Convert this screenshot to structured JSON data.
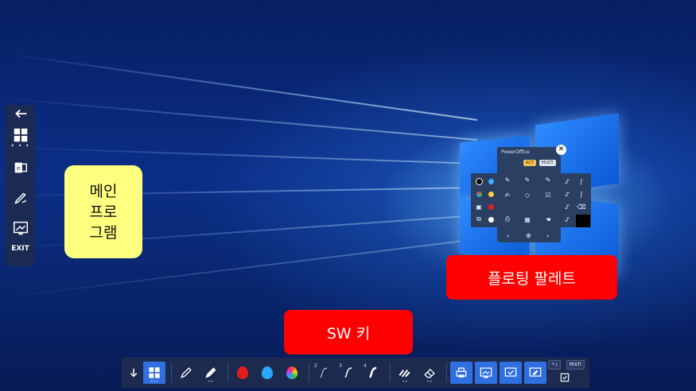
{
  "sidebar": {
    "back_icon": "back-arrow-icon",
    "items": [
      {
        "name": "windows",
        "icon": "windows-icon",
        "dots": "• • •"
      },
      {
        "name": "office",
        "icon": "office-icon",
        "dots": ""
      },
      {
        "name": "pen",
        "icon": "pen-icon",
        "dots": ""
      },
      {
        "name": "whiteboard",
        "icon": "whiteboard-icon",
        "dots": ""
      }
    ],
    "exit_label": "EXIT"
  },
  "callouts": {
    "main_program": "메인\n프로\n그램",
    "floating_palette": "플로팅 팔레트",
    "sw_key": "SW 키"
  },
  "palette": {
    "title": "PowerOffice",
    "act_label": "ACT",
    "multi_label": "MULTI",
    "nav_prev": "‹",
    "nav_home": "⊕",
    "nav_next": "›"
  },
  "taskbar": {
    "collapse_icon": "down-arrow-icon",
    "pen_numbers": [
      "2",
      "3",
      "4"
    ],
    "right_label": "MULTI",
    "right_tag": "⇡⇣"
  },
  "colors": {
    "red_label": "#ff0000",
    "yellow_label": "#ffff80",
    "bar_bg": "#1b2a4e",
    "accent": "#2f6fe0"
  }
}
